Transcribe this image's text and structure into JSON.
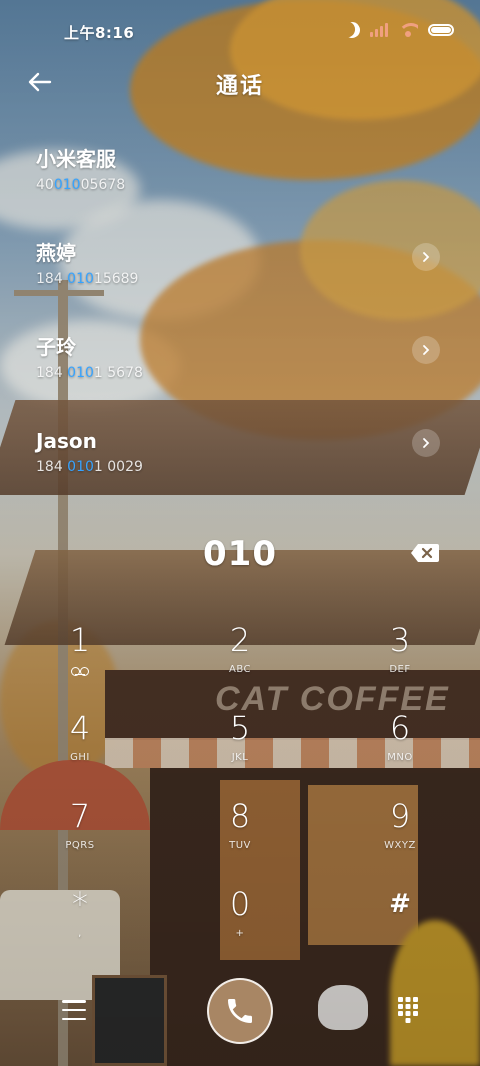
{
  "status_bar": {
    "time": "上午8:16",
    "icons": [
      "moon-icon",
      "signal-icon",
      "wifi-icon",
      "battery-icon"
    ],
    "accent_color": "#f0a080",
    "battery_level": 1.0
  },
  "header": {
    "title": "通话",
    "back_icon": "arrow-left-icon"
  },
  "results": [
    {
      "name": "小米客服",
      "number_prefix": "40",
      "number_match": "010",
      "number_suffix": "05678"
    },
    {
      "name": "燕婷",
      "number_prefix": "184 ",
      "number_match": "010",
      "number_suffix": "15689"
    },
    {
      "name": "子玲",
      "number_prefix": "184 ",
      "number_match": "010",
      "number_suffix": "1 5678"
    },
    {
      "name": "Jason",
      "number_prefix": "184 ",
      "number_match": "010",
      "number_suffix": "1 0029"
    }
  ],
  "highlight_color": "#36a3ff",
  "dial": {
    "number": "010",
    "delete_icon": "backspace-icon"
  },
  "keypad": {
    "keys": [
      {
        "digit": "1",
        "letters": ""
      },
      {
        "digit": "2",
        "letters": "ABC"
      },
      {
        "digit": "3",
        "letters": "DEF"
      },
      {
        "digit": "4",
        "letters": "GHI"
      },
      {
        "digit": "5",
        "letters": "JKL"
      },
      {
        "digit": "6",
        "letters": "MNO"
      },
      {
        "digit": "7",
        "letters": "PQRS"
      },
      {
        "digit": "8",
        "letters": "TUV"
      },
      {
        "digit": "9",
        "letters": "WXYZ"
      },
      {
        "digit": "*",
        "letters": ","
      },
      {
        "digit": "0",
        "letters": "+"
      },
      {
        "digit": "#",
        "letters": ""
      }
    ]
  },
  "bottom_bar": {
    "menu_icon": "hamburger-menu-icon",
    "call_icon": "phone-icon",
    "call_button_color": "#a88664",
    "keypad_icon": "dialpad-icon"
  }
}
